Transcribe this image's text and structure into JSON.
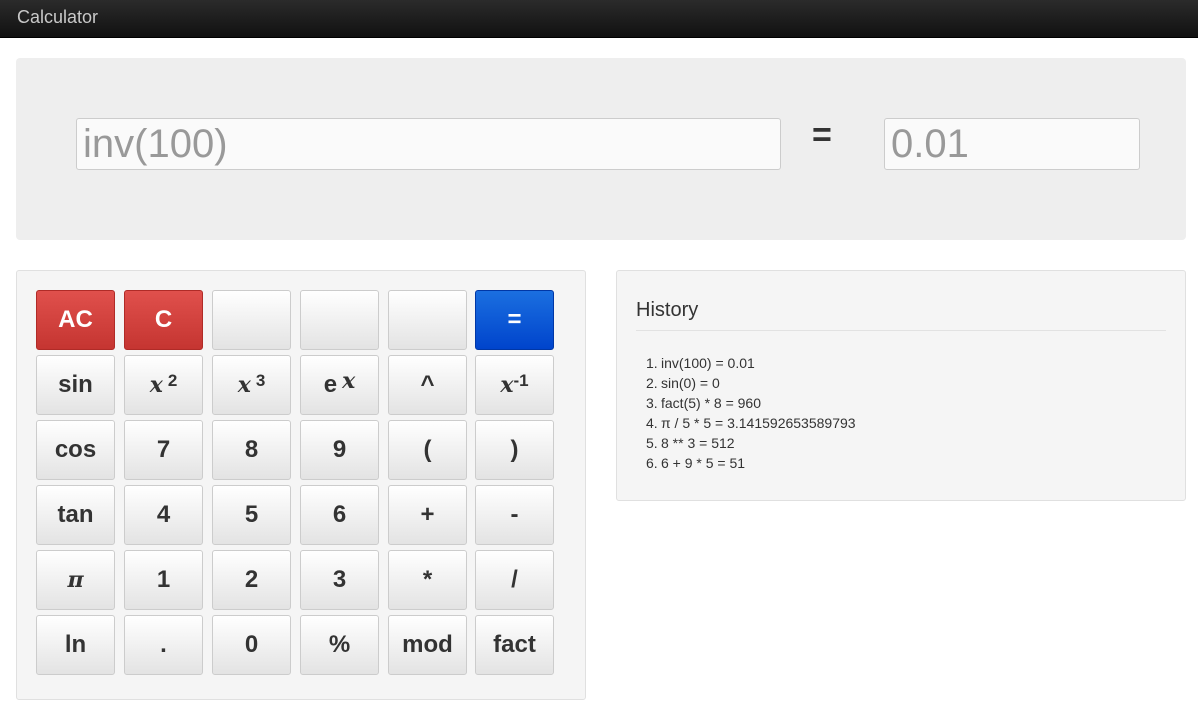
{
  "app": {
    "title": "Calculator"
  },
  "display": {
    "expression": "inv(100)",
    "equals": "=",
    "result": "0.01"
  },
  "keypad": {
    "keys": [
      {
        "label": "AC",
        "name": "all-clear-button"
      },
      {
        "label": "C",
        "name": "clear-button"
      },
      {
        "label": "",
        "name": "blank-key-1"
      },
      {
        "label": "",
        "name": "blank-key-2"
      },
      {
        "label": "",
        "name": "blank-key-3"
      },
      {
        "label": "=",
        "name": "equals-button"
      },
      {
        "label": "sin",
        "name": "sin-button"
      },
      {
        "label": "x",
        "sup": "2",
        "name": "square-button"
      },
      {
        "label": "x",
        "sup": "3",
        "name": "cube-button"
      },
      {
        "label": "e",
        "sup": "x",
        "name": "exp-button"
      },
      {
        "label": "^",
        "name": "power-button"
      },
      {
        "label": "x",
        "sup": "-1",
        "name": "inverse-button"
      },
      {
        "label": "cos",
        "name": "cos-button"
      },
      {
        "label": "7",
        "name": "digit-7-button"
      },
      {
        "label": "8",
        "name": "digit-8-button"
      },
      {
        "label": "9",
        "name": "digit-9-button"
      },
      {
        "label": "(",
        "name": "open-paren-button"
      },
      {
        "label": ")",
        "name": "close-paren-button"
      },
      {
        "label": "tan",
        "name": "tan-button"
      },
      {
        "label": "4",
        "name": "digit-4-button"
      },
      {
        "label": "5",
        "name": "digit-5-button"
      },
      {
        "label": "6",
        "name": "digit-6-button"
      },
      {
        "label": "+",
        "name": "plus-button"
      },
      {
        "label": "-",
        "name": "minus-button"
      },
      {
        "label": "π",
        "name": "pi-button"
      },
      {
        "label": "1",
        "name": "digit-1-button"
      },
      {
        "label": "2",
        "name": "digit-2-button"
      },
      {
        "label": "3",
        "name": "digit-3-button"
      },
      {
        "label": "*",
        "name": "multiply-button"
      },
      {
        "label": "/",
        "name": "divide-button"
      },
      {
        "label": "ln",
        "name": "ln-button"
      },
      {
        "label": ".",
        "name": "decimal-button"
      },
      {
        "label": "0",
        "name": "digit-0-button"
      },
      {
        "label": "%",
        "name": "percent-button"
      },
      {
        "label": "mod",
        "name": "mod-button"
      },
      {
        "label": "fact",
        "name": "fact-button"
      }
    ]
  },
  "history": {
    "title": "History",
    "entries": [
      {
        "num": "1.",
        "text": "inv(100) = 0.01"
      },
      {
        "num": "2.",
        "text": "sin(0) = 0"
      },
      {
        "num": "3.",
        "text": "fact(5) * 8 = 960"
      },
      {
        "num": "4.",
        "text": "π / 5 * 5 = 3.141592653589793"
      },
      {
        "num": "5.",
        "text": "8 ** 3 = 512"
      },
      {
        "num": "6.",
        "text": "6 + 9 * 5 = 51"
      }
    ]
  },
  "colors": {
    "clear_buttons": "#d9534f",
    "equals_button": "#0055dd",
    "navbar": "#1b1b1b",
    "panel": "#eeeeee"
  }
}
